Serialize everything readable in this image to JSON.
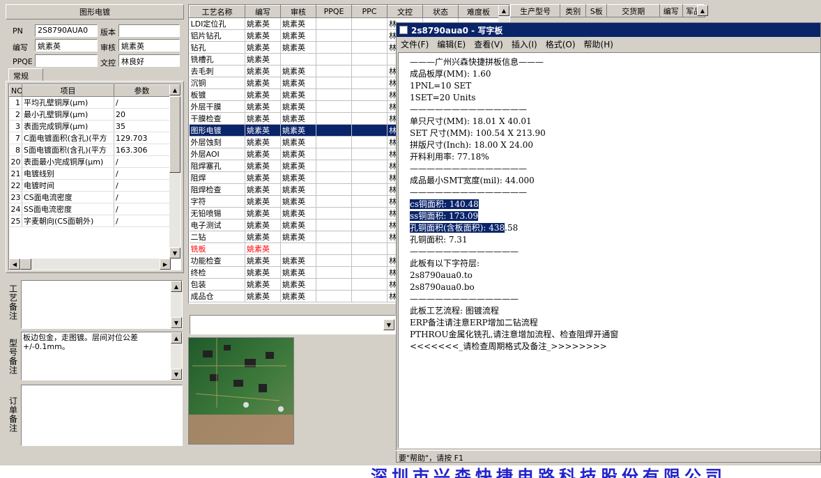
{
  "left": {
    "title": "图形电镀",
    "pn_label": "PN",
    "pn_value": "2S8790AUA0",
    "version_label": "版本",
    "version_value": "",
    "author_label": "编写",
    "author_value": "姚素英",
    "review_label": "审核",
    "review_value": "姚素英",
    "ppqe_label": "PPQE",
    "ppqe_value": "",
    "doc_label": "文控",
    "doc_value": "林良好",
    "tab_label": "常规",
    "params_headers": [
      "NO",
      "项目",
      "参数"
    ],
    "params": [
      {
        "no": "1",
        "item": "平均孔壁铜厚(μm)",
        "val": "/"
      },
      {
        "no": "2",
        "item": "最小孔壁铜厚(μm)",
        "val": "20"
      },
      {
        "no": "3",
        "item": "表面完成铜厚(μm)",
        "val": "35"
      },
      {
        "no": "7",
        "item": "C面电镀面积(含孔)(平方",
        "val": "129.703"
      },
      {
        "no": "8",
        "item": "S面电镀面积(含孔)(平方",
        "val": "163.306"
      },
      {
        "no": "20",
        "item": "表面最小完成铜厚(μm)",
        "val": "/"
      },
      {
        "no": "21",
        "item": "电镀线别",
        "val": "/"
      },
      {
        "no": "22",
        "item": "电镀时间",
        "val": "/"
      },
      {
        "no": "23",
        "item": "CS面电流密度",
        "val": "/"
      },
      {
        "no": "24",
        "item": "SS面电流密度",
        "val": "/"
      },
      {
        "no": "25",
        "item": "字麦朝向(CS面朝外)",
        "val": "/"
      }
    ],
    "process_note_label": "工艺备注",
    "model_note_label": "型号备注",
    "model_note_text": "板边包金，走图镀。层间对位公差+/-0.1mm。",
    "order_note_label": "订单备注"
  },
  "grid": {
    "headers": [
      "工艺名称",
      "编写",
      "审核",
      "PPQE",
      "PPC",
      "文控",
      "状态",
      "难度板"
    ],
    "rows": [
      {
        "name": "LDI定位孔",
        "w": "姚素英",
        "r": "姚素英",
        "d": "林"
      },
      {
        "name": "铝片钻孔",
        "w": "姚素英",
        "r": "姚素英",
        "d": "林"
      },
      {
        "name": "钻孔",
        "w": "姚素英",
        "r": "姚素英",
        "d": "林"
      },
      {
        "name": "铣槽孔",
        "w": "姚素英",
        "r": "",
        "d": ""
      },
      {
        "name": "去毛刺",
        "w": "姚素英",
        "r": "姚素英",
        "d": "林"
      },
      {
        "name": "沉铜",
        "w": "姚素英",
        "r": "姚素英",
        "d": "林"
      },
      {
        "name": "板镀",
        "w": "姚素英",
        "r": "姚素英",
        "d": "林"
      },
      {
        "name": "外层干膜",
        "w": "姚素英",
        "r": "姚素英",
        "d": "林"
      },
      {
        "name": "干膜检查",
        "w": "姚素英",
        "r": "姚素英",
        "d": "林"
      },
      {
        "name": "图形电镀",
        "w": "姚素英",
        "r": "姚素英",
        "d": "林"
      },
      {
        "name": "外层蚀刻",
        "w": "姚素英",
        "r": "姚素英",
        "d": "林"
      },
      {
        "name": "外层AOI",
        "w": "姚素英",
        "r": "姚素英",
        "d": "林"
      },
      {
        "name": "阻焊塞孔",
        "w": "姚素英",
        "r": "姚素英",
        "d": "林"
      },
      {
        "name": "阻焊",
        "w": "姚素英",
        "r": "姚素英",
        "d": "林"
      },
      {
        "name": "阻焊检查",
        "w": "姚素英",
        "r": "姚素英",
        "d": "林"
      },
      {
        "name": "字符",
        "w": "姚素英",
        "r": "姚素英",
        "d": "林"
      },
      {
        "name": "无铅喷锡",
        "w": "姚素英",
        "r": "姚素英",
        "d": "林"
      },
      {
        "name": "电子测试",
        "w": "姚素英",
        "r": "姚素英",
        "d": "林"
      },
      {
        "name": "二钻",
        "w": "姚素英",
        "r": "姚素英",
        "d": "林"
      },
      {
        "name": "铣板",
        "w": "姚素英",
        "r": "",
        "d": ""
      },
      {
        "name": "功能检查",
        "w": "姚素英",
        "r": "姚素英",
        "d": "林"
      },
      {
        "name": "终检",
        "w": "姚素英",
        "r": "姚素英",
        "d": "林"
      },
      {
        "name": "包装",
        "w": "姚素英",
        "r": "姚素英",
        "d": "林"
      },
      {
        "name": "成品仓",
        "w": "姚素英",
        "r": "姚素英",
        "d": "林"
      }
    ],
    "selected_index": 9,
    "red_index": 19
  },
  "right_grid": {
    "headers": [
      "生产型号",
      "类别",
      "S板",
      "交货期",
      "编写",
      "军品"
    ]
  },
  "notepad": {
    "title": "2s8790aua0 - 写字板",
    "menu": [
      "文件(F)",
      "编辑(E)",
      "查看(V)",
      "插入(I)",
      "格式(O)",
      "帮助(H)"
    ],
    "lines": [
      "———广州兴森快捷拼板信息———",
      "成品板厚(MM): 1.60",
      "1PNL=10 SET",
      "1SET=20 Units",
      "——————————————",
      "单只尺寸(MM): 18.01 X 40.01",
      "SET 尺寸(MM): 100.54 X 213.90",
      "拼版尺寸(Inch): 18.00 X 24.00",
      "开料利用率: 77.18%",
      "——————————————",
      "成品最小SMT宽度(mil): 44.000",
      "——————————————",
      "cs铜面积: 140.48",
      "ss铜面积: 173.09",
      "孔铜面积(含板面积): 438.58",
      "孔铜面积: 7.31",
      "—————————————",
      "此板有以下字符层:",
      "2s8790aua0.to",
      "2s8790aua0.bo",
      "—————————————",
      "此板工艺流程: 图镀流程",
      "ERP备注请注意ERP增加二钻流程",
      "PTHROU金属化铣孔,请注意增加流程、检查阻焊开通窗",
      "<<<<<<<_请检查周期格式及备注_>>>>>>>>"
    ],
    "highlight": [
      {
        "line": 12,
        "text": "cs铜面积: 140.48",
        "rest": ""
      },
      {
        "line": 13,
        "text": "ss铜面积: 173.09",
        "rest": ""
      },
      {
        "line": 14,
        "text": "孔铜面积(含板面积): 438",
        "rest": ".58"
      }
    ],
    "status": "要\"帮助\"，请按 F1"
  },
  "bottom_banner": "深圳市兴森快捷电路科技股份有限公司"
}
